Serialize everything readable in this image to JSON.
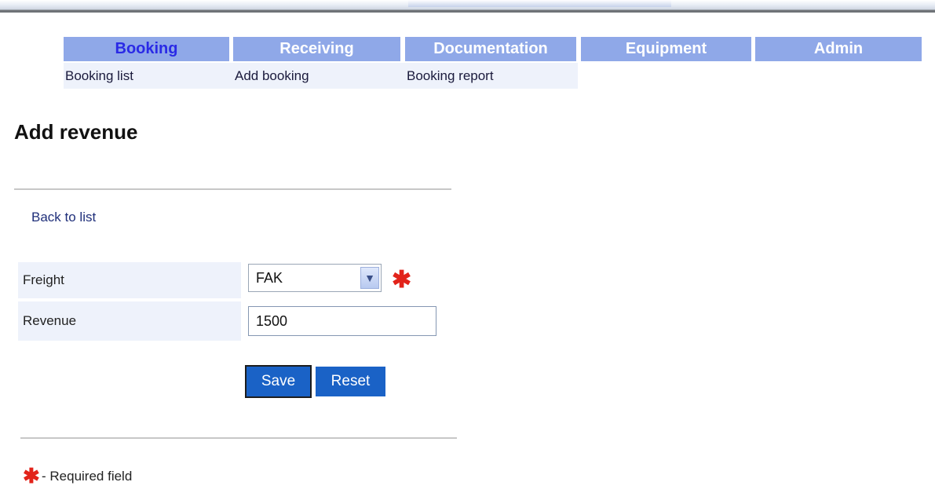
{
  "nav": {
    "tabs": [
      {
        "label": "Booking"
      },
      {
        "label": "Receiving"
      },
      {
        "label": "Documentation"
      },
      {
        "label": "Equipment"
      },
      {
        "label": "Admin"
      }
    ],
    "subitems": [
      {
        "label": "Booking list"
      },
      {
        "label": "Add booking"
      },
      {
        "label": "Booking report"
      }
    ]
  },
  "page": {
    "title": "Add revenue",
    "back_link": "Back to list"
  },
  "form": {
    "freight_label": "Freight",
    "freight_value": "FAK",
    "revenue_label": "Revenue",
    "revenue_value": "1500",
    "save_label": "Save",
    "reset_label": "Reset",
    "required_marker": "✱"
  },
  "legend": {
    "marker": "✱",
    "text": "- Required field"
  },
  "colors": {
    "tab_bg": "#8fa8e8",
    "active_tab_text": "#2a2ae6",
    "button_bg": "#1a62c6",
    "required_star": "#e2231a"
  }
}
